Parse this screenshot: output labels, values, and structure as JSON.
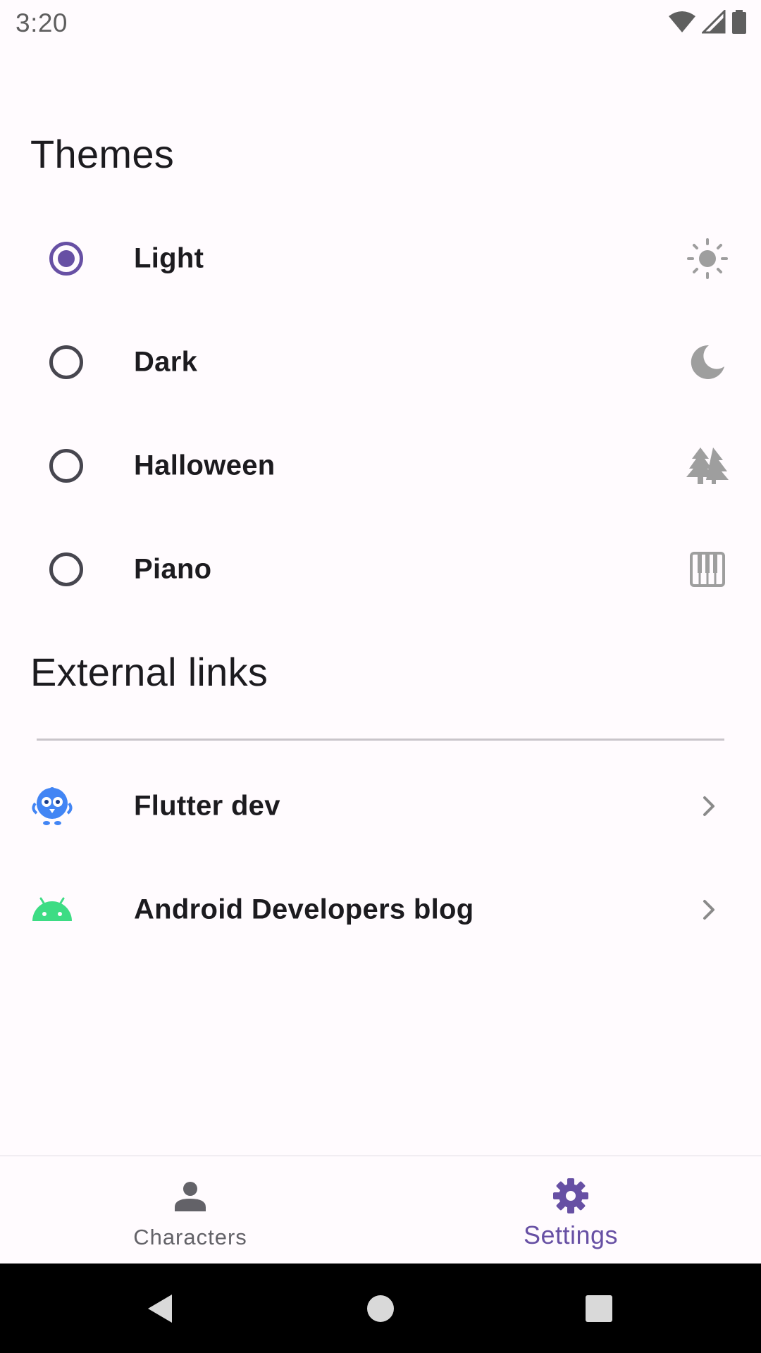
{
  "status_bar": {
    "time": "3:20",
    "icons": [
      "wifi-icon",
      "signal-icon",
      "battery-icon"
    ]
  },
  "themes": {
    "title": "Themes",
    "selected": "Light",
    "items": [
      {
        "label": "Light",
        "selected": true,
        "icon": "sun-icon"
      },
      {
        "label": "Dark",
        "selected": false,
        "icon": "moon-icon"
      },
      {
        "label": "Halloween",
        "selected": false,
        "icon": "trees-icon"
      },
      {
        "label": "Piano",
        "selected": false,
        "icon": "piano-icon"
      }
    ]
  },
  "external_links": {
    "title": "External links",
    "items": [
      {
        "label": "Flutter dev",
        "icon": "dash-mascot-icon"
      },
      {
        "label": "Android Developers blog",
        "icon": "android-icon"
      }
    ]
  },
  "bottom_nav": {
    "items": [
      {
        "label": "Characters",
        "icon": "person-icon",
        "active": false
      },
      {
        "label": "Settings",
        "icon": "gear-icon",
        "active": true
      }
    ]
  },
  "colors": {
    "accent": "#6750a4",
    "background": "#fffbfe",
    "icon_gray": "#9e9e9e",
    "android_green": "#3ddc84",
    "flutter_blue": "#4285f4"
  }
}
